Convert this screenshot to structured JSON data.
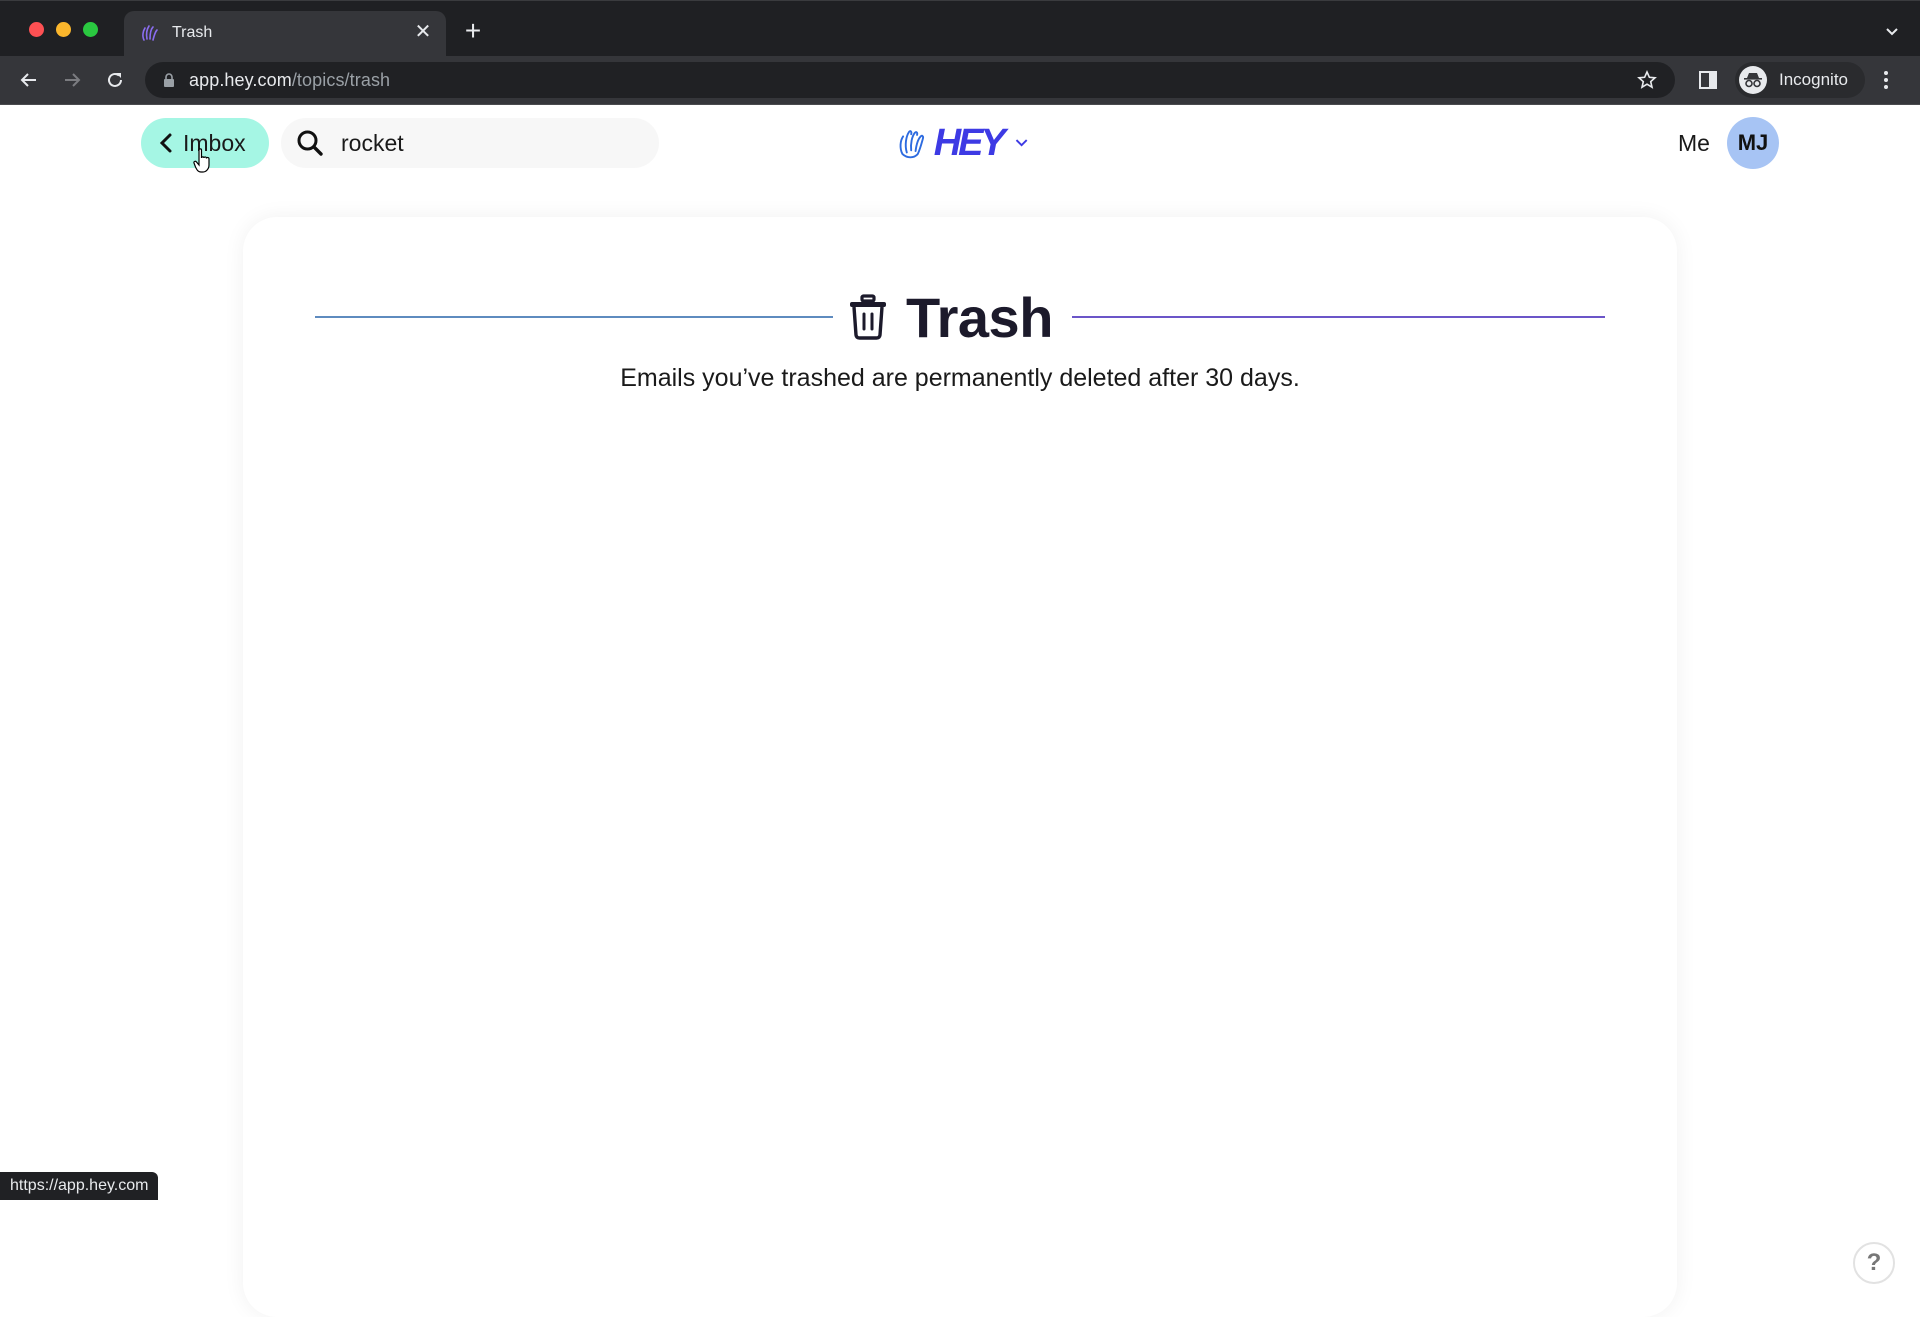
{
  "browser": {
    "tab": {
      "title": "Trash",
      "favicon": "hey-hand-icon"
    },
    "url_host": "app.hey.com",
    "url_path": "/topics/trash",
    "profile_label": "Incognito",
    "status_url": "https://app.hey.com"
  },
  "header": {
    "back_label": "Imbox",
    "search_value": "rocket",
    "logo_text": "HEY",
    "me_label": "Me",
    "avatar_initials": "MJ"
  },
  "page": {
    "title": "Trash",
    "subtitle": "Emails you’ve trashed are permanently deleted after 30 days."
  },
  "help": {
    "label": "?"
  },
  "colors": {
    "imbox_button": "#a5f6e4",
    "brand": "#3d3ae4",
    "avatar": "#a7c4f4",
    "rule_left": "#5e8bbf",
    "rule_right": "#6b55c8"
  }
}
